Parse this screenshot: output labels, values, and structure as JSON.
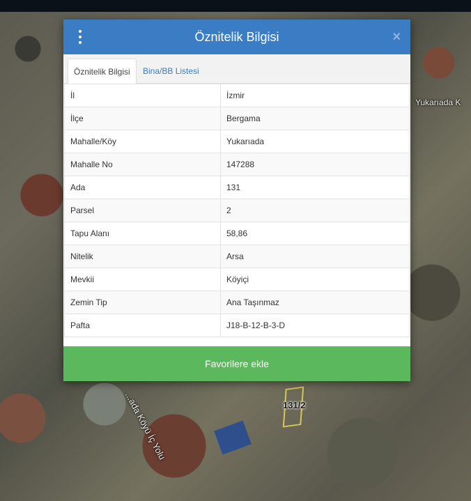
{
  "map": {
    "road_label": "...ada Köyü İç Yolu",
    "area_label": "Yukarıada K",
    "parcel_label": "131/2"
  },
  "modal": {
    "title": "Öznitelik Bilgisi",
    "close_symbol": "×",
    "tabs": [
      {
        "label": "Öznitelik Bilgisi",
        "active": true
      },
      {
        "label": "Bina/BB Listesi",
        "active": false
      }
    ],
    "rows": [
      {
        "key": "İl",
        "value": "İzmir"
      },
      {
        "key": "İlçe",
        "value": "Bergama"
      },
      {
        "key": "Mahalle/Köy",
        "value": "Yukarıada"
      },
      {
        "key": "Mahalle No",
        "value": "147288"
      },
      {
        "key": "Ada",
        "value": "131"
      },
      {
        "key": "Parsel",
        "value": "2"
      },
      {
        "key": "Tapu Alanı",
        "value": "58,86"
      },
      {
        "key": "Nitelik",
        "value": "Arsa"
      },
      {
        "key": "Mevkii",
        "value": "Köyiçi"
      },
      {
        "key": "Zemin Tip",
        "value": "Ana Taşınmaz"
      },
      {
        "key": "Pafta",
        "value": "J18-B-12-B-3-D"
      }
    ],
    "favorite_button_label": "Favorilere ekle"
  },
  "colors": {
    "header": "#3b7dc4",
    "button": "#5cb85c",
    "tab_link": "#3b7dc4"
  },
  "icons": {
    "menu": "kebab-menu-icon",
    "close": "close-icon"
  }
}
